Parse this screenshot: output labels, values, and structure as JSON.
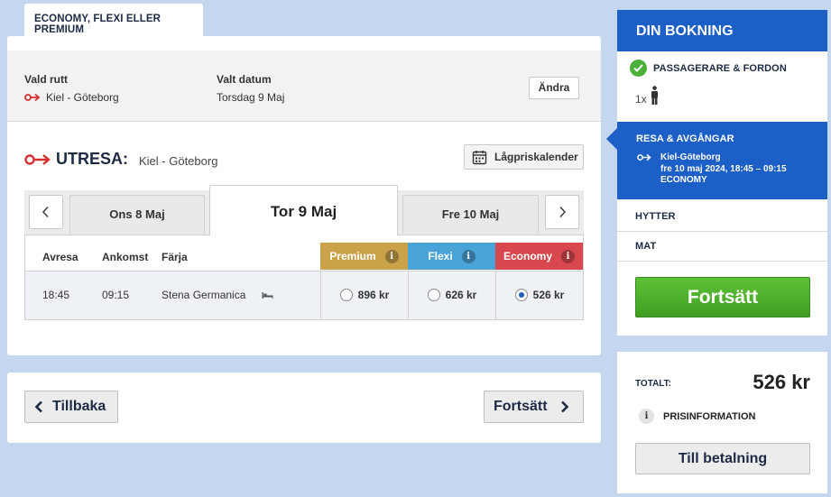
{
  "tab": {
    "label": "ECONOMY, FLEXI ELLER PREMIUM"
  },
  "route_summary": {
    "route_label": "Vald rutt",
    "route_value": "Kiel - Göteborg",
    "date_label": "Valt datum",
    "date_value": "Torsdag 9 Maj",
    "change_button": "Ändra"
  },
  "outbound": {
    "title": "UTRESA:",
    "route": "Kiel - Göteborg",
    "calendar_button": "Lågpriskalender"
  },
  "date_nav": {
    "prev": "Ons 8 Maj",
    "current": "Tor 9 Maj",
    "next": "Fre 10 Maj"
  },
  "table": {
    "headers": {
      "depart": "Avresa",
      "arrive": "Ankomst",
      "ferry": "Färja"
    },
    "fares": [
      {
        "name": "Premium",
        "color": "#c9a24a",
        "price": "896 kr",
        "selected": false
      },
      {
        "name": "Flexi",
        "color": "#4aa3d6",
        "price": "626 kr",
        "selected": false
      },
      {
        "name": "Economy",
        "color": "#d8474d",
        "price": "526 kr",
        "selected": true
      }
    ],
    "row": {
      "depart": "18:45",
      "arrive": "09:15",
      "ferry": "Stena Germanica"
    }
  },
  "bottom_nav": {
    "back": "Tillbaka",
    "forward": "Fortsätt"
  },
  "sidebar": {
    "title": "DIN BOKNING",
    "passengers_label": "PASSAGERARE & FORDON",
    "passenger_count": "1x",
    "active_step": {
      "label": "RESA & AVGÅNGAR",
      "route": "Kiel-Göteborg",
      "time": "fre 10 maj 2024, 18:45 – 09:15",
      "fare": "ECONOMY"
    },
    "cabins": "HYTTER",
    "food": "MAT",
    "continue_button": "Fortsätt"
  },
  "total": {
    "label": "TOTALT:",
    "amount": "526 kr",
    "price_info": "PRISINFORMATION",
    "pay_button": "Till betalning"
  },
  "colors": {
    "brand_blue": "#1c5fc7",
    "green": "#4caf38",
    "red_arrow": "#d62f2f"
  }
}
